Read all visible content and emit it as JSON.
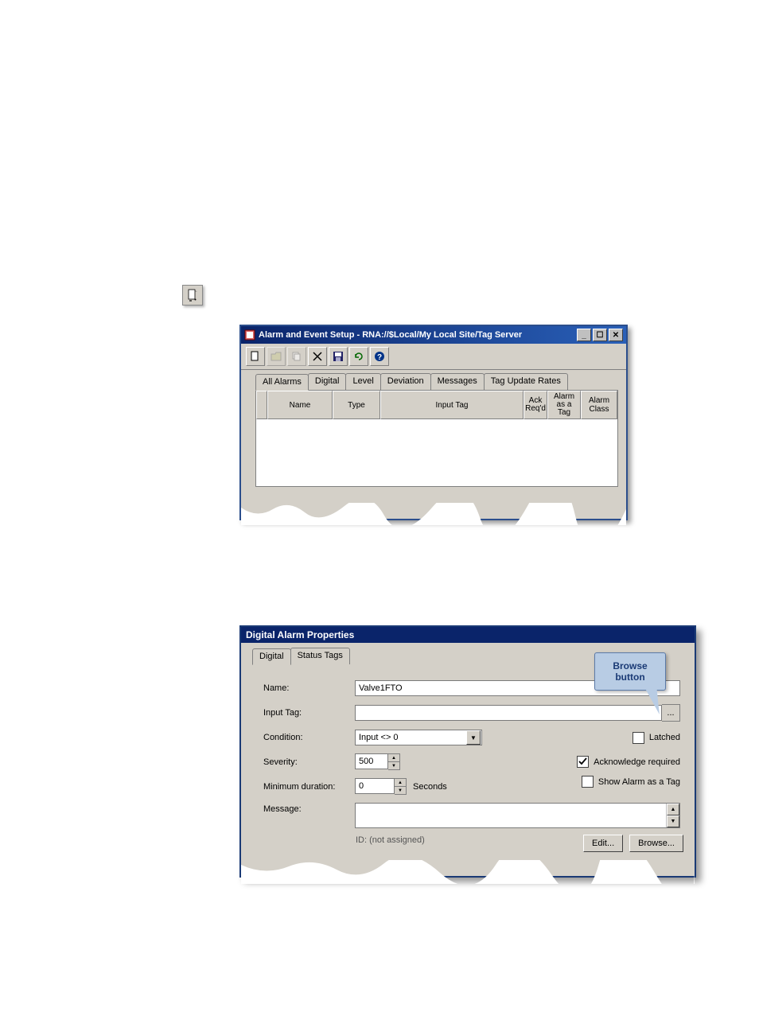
{
  "standaloneIcon": {
    "name": "new-document-icon"
  },
  "window1": {
    "title": "Alarm and Event Setup - RNA://$Local/My Local Site/Tag Server",
    "tabs": [
      "All Alarms",
      "Digital",
      "Level",
      "Deviation",
      "Messages",
      "Tag Update Rates"
    ],
    "columns": [
      "Name",
      "Type",
      "Input Tag",
      "Ack Req'd",
      "Alarm as a Tag",
      "Alarm Class"
    ]
  },
  "window2": {
    "title": "Digital Alarm Properties",
    "tabs": [
      "Digital",
      "Status Tags"
    ],
    "labels": {
      "name": "Name:",
      "inputTag": "Input Tag:",
      "condition": "Condition:",
      "severity": "Severity:",
      "minDuration": "Minimum duration:",
      "message": "Message:"
    },
    "values": {
      "name": "Valve1FTO",
      "condition": "Input <> 0",
      "severity": "500",
      "minDuration": "0",
      "minDurationUnits": "Seconds"
    },
    "checkboxes": {
      "latched": {
        "label": "Latched",
        "checked": false
      },
      "ackRequired": {
        "label": "Acknowledge required",
        "checked": true
      },
      "showAsTag": {
        "label": "Show Alarm as a Tag",
        "checked": false
      }
    },
    "idText": "ID: (not assigned)",
    "buttons": {
      "edit": "Edit...",
      "browse": "Browse..."
    }
  },
  "callout": {
    "line1": "Browse",
    "line2": "button"
  }
}
